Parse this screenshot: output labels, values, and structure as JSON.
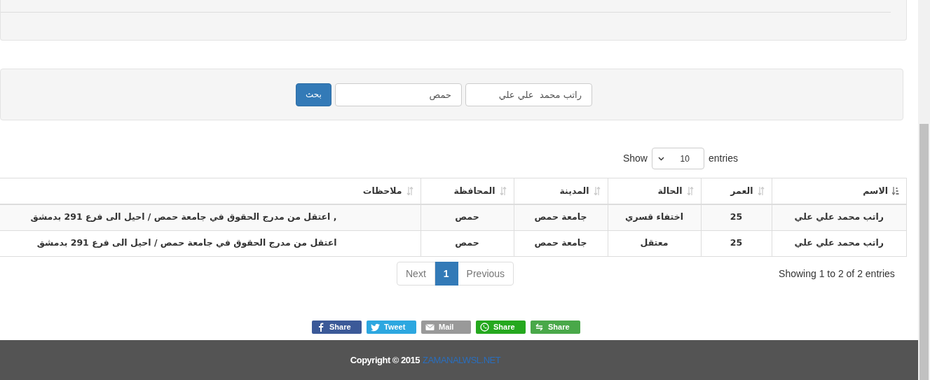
{
  "search": {
    "fields": [
      {
        "value": "راتب محمد  علي علي"
      },
      {
        "value": "حمص"
      }
    ],
    "button": "بحث"
  },
  "length": {
    "prefix": "Show",
    "value": "10",
    "suffix": "entries"
  },
  "table": {
    "columns": [
      {
        "label": "الاسم",
        "sorted": true
      },
      {
        "label": "العمر",
        "sorted": false
      },
      {
        "label": "الحالة",
        "sorted": false
      },
      {
        "label": "المدينة",
        "sorted": false
      },
      {
        "label": "المحافظة",
        "sorted": false
      },
      {
        "label": "ملاحظات",
        "sorted": false
      }
    ],
    "rows": [
      [
        "راتب محمد علي علي",
        "25",
        "اختفاء قسري",
        "جامعة حمص",
        "حمص",
        ", اعتقل من مدرج الحقوق في جامعة حمص / احيل الى فرع 291 بدمشق"
      ],
      [
        "راتب محمد علي علي",
        "25",
        "معتقل",
        "جامعة حمص",
        "حمص",
        "اعتقل من مدرج الحقوق في جامعة حمص / احيل الى فرع 291 بدمشق"
      ]
    ]
  },
  "info": "Showing 1 to 2 of 2 entries",
  "pagination": [
    {
      "label": "Previous",
      "selected": false
    },
    {
      "label": "1",
      "selected": true
    },
    {
      "label": "Next",
      "selected": false
    }
  ],
  "share": [
    {
      "label": "Share",
      "kind": "sharethis",
      "color": "#49a849"
    },
    {
      "label": "Share",
      "kind": "whatsapp",
      "color": "#25a81e"
    },
    {
      "label": "Mail",
      "kind": "mail",
      "color": "#999999"
    },
    {
      "label": "Tweet",
      "kind": "twitter",
      "color": "#2ca7e0"
    },
    {
      "label": "Share",
      "kind": "facebook",
      "color": "#3b5998"
    }
  ],
  "footer": {
    "text": "Copyright © 2015",
    "link": "ZAMANALWSL.NET"
  }
}
